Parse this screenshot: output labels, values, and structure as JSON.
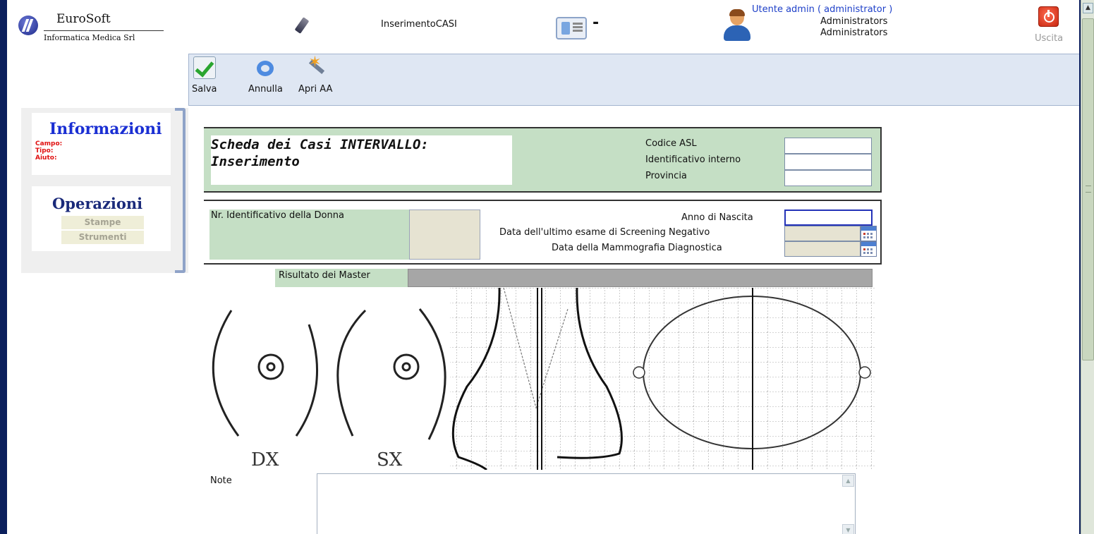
{
  "header": {
    "company_name": "EuroSoft",
    "company_subtitle": "Informatica Medica Srl",
    "page_name": "InserimentoCASI",
    "separator": "-",
    "user_line": "Utente admin ( administrator )",
    "group_1": "Administrators",
    "group_2": "Administrators",
    "exit_label": "Uscita"
  },
  "toolbar": {
    "save_label": "Salva",
    "cancel_label": "Annulla",
    "open_aa_label": "Apri AA"
  },
  "left_panel": {
    "info_title": "Informazioni",
    "info_field_1": "Campo:",
    "info_field_2": "Tipo:",
    "info_field_3": "Aiuto:",
    "operations_title": "Operazioni",
    "print_button": "Stampe",
    "tools_button": "Strumenti"
  },
  "form": {
    "title_line_1": "Scheda dei Casi INTERVALLO:",
    "title_line_2": "Inserimento",
    "codice_asl_label": "Codice ASL",
    "id_interno_label": "Identificativo interno",
    "provincia_label": "Provincia",
    "nr_id_donna_label": "Nr. Identificativo della Donna",
    "anno_nascita_label": "Anno di Nascita",
    "data_ultimo_esame_label": "Data dell'ultimo esame di Screening Negativo",
    "data_mammografia_label": "Data della Mammografia Diagnostica",
    "risultato_master_label": "Risultato dei Master",
    "note_label": "Note"
  },
  "diagram": {
    "right_label": "DX",
    "left_label": "SX"
  },
  "colors": {
    "form_green": "#c5dfc5",
    "info_blue": "#1a2fd3",
    "field_red": "#e01010",
    "toolbar_bg": "#dfe7f3"
  }
}
